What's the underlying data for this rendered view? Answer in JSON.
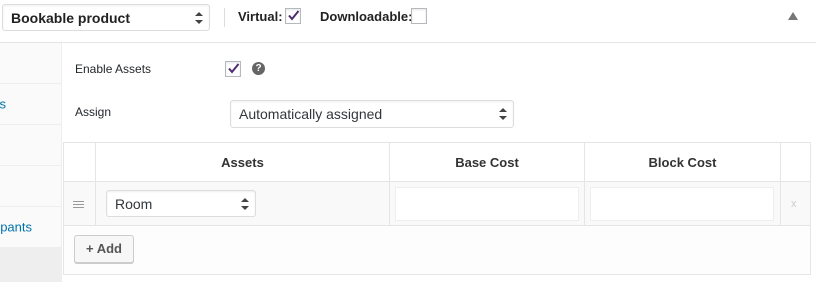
{
  "header": {
    "product_type": "Bookable product",
    "virtual_label": "Virtual:",
    "virtual_checked": true,
    "downloadable_label": "Downloadable:",
    "downloadable_checked": false
  },
  "tabs": [
    {
      "label": "s"
    },
    {
      "label": ""
    },
    {
      "label": ""
    },
    {
      "label": "pants"
    },
    {
      "label": ""
    }
  ],
  "assets": {
    "enable_label": "Enable Assets",
    "enable_checked": true,
    "assign_label": "Assign",
    "assign_value": "Automatically assigned"
  },
  "table": {
    "columns": [
      "Assets",
      "Base Cost",
      "Block Cost"
    ],
    "rows": [
      {
        "asset": "Room",
        "base_cost": "",
        "block_cost": "",
        "remove": "x"
      }
    ],
    "add_label": "+ Add"
  },
  "colors": {
    "accent": "#0073aa",
    "check": "#4d2b6d"
  }
}
